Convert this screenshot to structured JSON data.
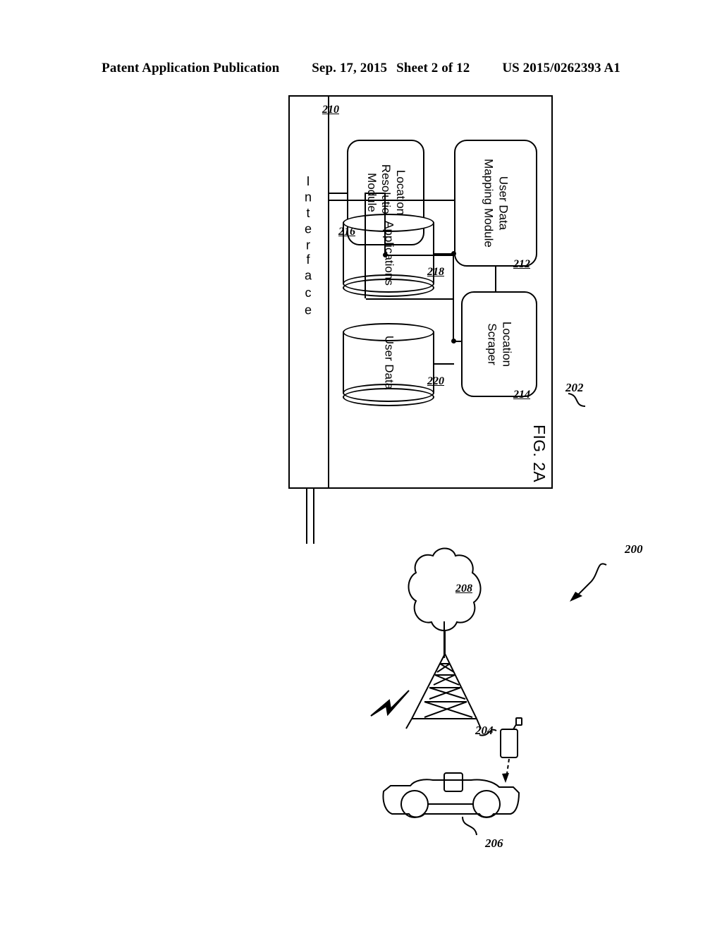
{
  "header": {
    "publication": "Patent Application Publication",
    "date": "Sep. 17, 2015",
    "sheet": "Sheet 2 of 12",
    "patent_number": "US 2015/0262393 A1"
  },
  "figure": {
    "caption": "FIG. 2A",
    "diagram_ref": "200",
    "system_ref": "202"
  },
  "interface": {
    "letters": [
      "I",
      "n",
      "t",
      "e",
      "r",
      "f",
      "a",
      "c",
      "e"
    ],
    "label": "Interface",
    "ref": "210"
  },
  "modules": [
    {
      "id": "user-data-mapping-module",
      "label": "User Data\nMapping Module",
      "ref": "212"
    },
    {
      "id": "location-scraper",
      "label": "Location\nScraper",
      "ref": "214"
    },
    {
      "id": "location-resolution-module",
      "label": "Location\nResolution\nModule",
      "ref": "216"
    }
  ],
  "datastores": [
    {
      "id": "applications-store",
      "label": "Applications",
      "ref": "218"
    },
    {
      "id": "user-data-store",
      "label": "User Data",
      "ref": "220"
    }
  ],
  "external": [
    {
      "id": "mobile-device",
      "label": "",
      "ref": "204"
    },
    {
      "id": "vehicle",
      "label": "",
      "ref": "206"
    },
    {
      "id": "network-cloud",
      "label": "",
      "ref": "208"
    }
  ],
  "colors": {
    "ink": "#000000",
    "paper": "#ffffff"
  }
}
